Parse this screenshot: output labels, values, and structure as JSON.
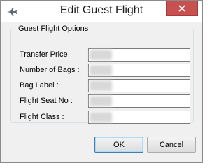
{
  "window": {
    "title": "Edit Guest Flight"
  },
  "group": {
    "legend": "Guest Flight Options"
  },
  "fields": [
    {
      "label": "Transfer Price",
      "value": ""
    },
    {
      "label": "Number of Bags :",
      "value": ""
    },
    {
      "label": "Bag Label :",
      "value": ""
    },
    {
      "label": "Flight Seat No :",
      "value": ""
    },
    {
      "label": "Flight Class :",
      "value": ""
    }
  ],
  "buttons": {
    "ok": "OK",
    "cancel": "Cancel"
  },
  "colors": {
    "close_button_bg": "#c75050",
    "dialog_bg": "#f0f0f0",
    "ok_focus_border": "#3c7fb1"
  },
  "icons": {
    "app": "airplane-icon",
    "close": "close-icon"
  }
}
